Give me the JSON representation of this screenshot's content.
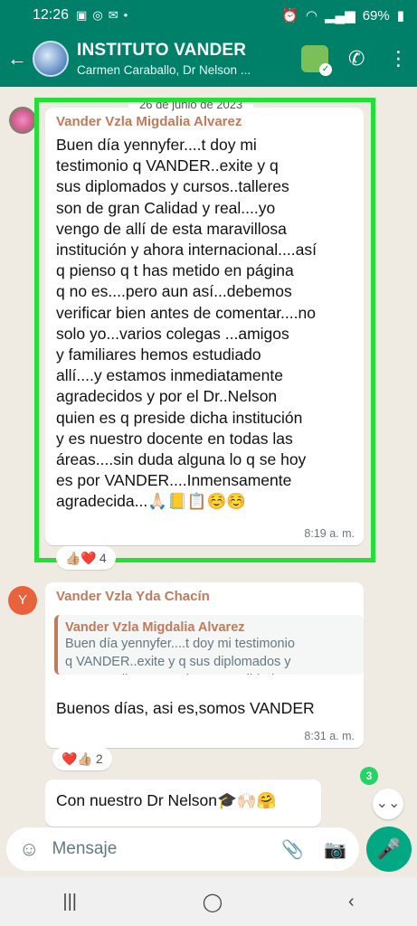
{
  "status_bar": {
    "time": "12:26",
    "battery": "69%"
  },
  "header": {
    "title": "INSTITUTO VANDER",
    "subtitle": "Carmen Caraballo, Dr Nelson ..."
  },
  "date_pill": "26 de junio de 2023",
  "messages": [
    {
      "sender": "Vander Vzla Migdalia Alvarez",
      "text": "Buen día yennyfer....t doy mi\ntestimonio q VANDER..exite y q\nsus diplomados y cursos..talleres\nson de gran Calidad y real....yo\nvengo de allí de esta maravillosa\ninstitución y ahora internacional....así\nq pienso q t has metido en página\nq no es....pero aun así...debemos\nverificar bien antes de comentar....no\nsolo yo...varios colegas ...amigos\ny familiares hemos estudiado\nallí....y estamos inmediatamente\nagradecidos y por el Dr..Nelson\nquien es q preside dicha institución\ny es nuestro docente en todas las\náreas....sin duda alguna lo q se hoy\nes por VANDER....Inmensamente\nagradecida...🙏🏻📒📋☺️☺️",
      "time": "8:19 a. m.",
      "reactions": "👍🏼❤️",
      "reaction_count": "4"
    },
    {
      "sender": "Vander Vzla Yda Chacín",
      "avatar_initial": "Y",
      "quote_sender": "Vander Vzla Migdalia Alvarez",
      "quote_text": "Buen día yennyfer....t doy mi testimonio\nq VANDER..exite y q sus diplomados y\ncursos..talleres son de gran Calidad y re...",
      "text": "Buenos días, asi es,somos VANDER",
      "time": "8:31 a. m.",
      "reactions": "❤️👍🏼",
      "reaction_count": "2"
    },
    {
      "text": "Con nuestro Dr Nelson🎓🙌🏻🤗"
    }
  ],
  "unread_count": "3",
  "input": {
    "placeholder": "Mensaje"
  },
  "icons": [
    "back-arrow-icon",
    "add-call-icon",
    "more-vert-icon",
    "emoji-icon",
    "attach-icon",
    "camera-icon",
    "mic-icon",
    "scroll-down-icon",
    "nav-recents-icon",
    "nav-home-icon",
    "nav-back-icon"
  ]
}
